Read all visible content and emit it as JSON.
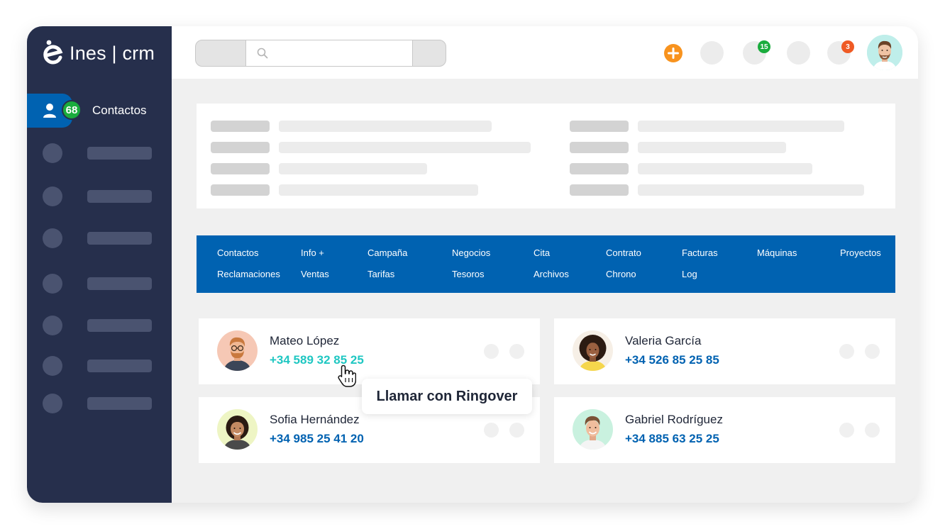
{
  "app": {
    "brand": "Ines | crm"
  },
  "sidebar": {
    "active": {
      "label": "Contactos",
      "count": "68"
    }
  },
  "topbar": {
    "search": {
      "placeholder": ""
    },
    "badges": {
      "notifications": "15",
      "alerts": "3"
    }
  },
  "tabs": [
    "Contactos",
    "Info +",
    "Campaña",
    "Negocios",
    "Cita",
    "Contrato",
    "Facturas",
    "Máquinas",
    "Proyectos",
    "Reclamaciones",
    "Ventas",
    "Tarifas",
    "Tesoros",
    "Archivos",
    "Chrono",
    "Log"
  ],
  "contacts": [
    {
      "name": "Mateo López",
      "phone": "+34 589 32 85 25"
    },
    {
      "name": "Valeria García",
      "phone": "+34 526 85 25 85"
    },
    {
      "name": "Sofia Hernández",
      "phone": "+34 985 25 41 20"
    },
    {
      "name": "Gabriel Rodríguez",
      "phone": "+34 885 63 25 25"
    }
  ],
  "tooltip": {
    "text": "Llamar con Ringover"
  },
  "colors": {
    "sidebar": "#262f4c",
    "primary": "#0062b1",
    "accent_hover": "#1fc7c2",
    "badge_green": "#1aac3d",
    "badge_orange": "#ef5a24",
    "add_orange": "#f8931e"
  },
  "icons": {
    "logo": "ines-logo-icon",
    "nav_contacts": "user-icon",
    "search": "search-icon",
    "add": "plus-icon",
    "cursor": "hand-pointer-icon"
  }
}
